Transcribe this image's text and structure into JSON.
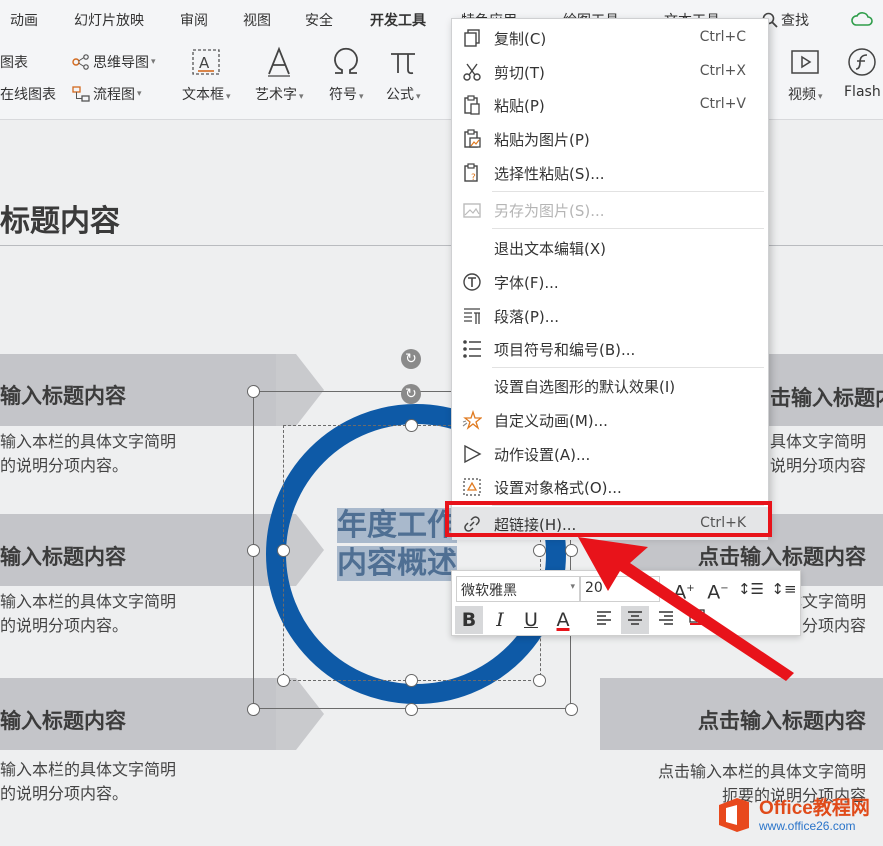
{
  "ribbon": {
    "tabs": [
      "动画",
      "幻灯片放映",
      "审阅",
      "视图",
      "安全",
      "开发工具",
      "特色应用",
      "绘图工具",
      "文本工具"
    ],
    "search": "查找",
    "tools_small": [
      "图表",
      "在线图表",
      "思维导图",
      "流程图"
    ],
    "tools_big": [
      "文本框",
      "艺术字",
      "符号",
      "公式",
      "视频",
      "Flash"
    ]
  },
  "slide": {
    "title": "标题内容",
    "items": [
      {
        "title": "输入标题内容",
        "body1": "输入本栏的具体文字简明",
        "body2": "的说明分项内容。"
      },
      {
        "title": "输入标题内容",
        "body1": "输入本栏的具体文字简明",
        "body2": "的说明分项内容。"
      },
      {
        "title": "输入标题内容",
        "body1": "输入本栏的具体文字简明",
        "body2": "的说明分项内容。"
      },
      {
        "title": "击输入标题内容",
        "body1": "具体文字简明",
        "body2": "说明分项内容"
      },
      {
        "title": "点击输入标题内容",
        "body1": "点击输入本栏的具体文字简明",
        "body2": "扼要的说明分项内容"
      },
      {
        "title": "点击输入标题内容",
        "body1": "点击输入本栏的具体文字简明",
        "body2": "扼要的说明分项内容"
      }
    ],
    "center_line1": "年度工作",
    "center_line2": "内容概述",
    "ring_color": "#0e5aa7"
  },
  "context_menu": {
    "items": [
      {
        "label": "复制(C)",
        "shortcut": "Ctrl+C",
        "icon": "copy-icon"
      },
      {
        "label": "剪切(T)",
        "shortcut": "Ctrl+X",
        "icon": "scissors-icon"
      },
      {
        "label": "粘贴(P)",
        "shortcut": "Ctrl+V",
        "icon": "paste-icon"
      },
      {
        "label": "粘贴为图片(P)",
        "shortcut": "",
        "icon": "paste-image-icon"
      },
      {
        "label": "选择性粘贴(S)...",
        "shortcut": "",
        "icon": "paste-special-icon"
      },
      {
        "label": "另存为图片(S)...",
        "shortcut": "",
        "icon": "image-icon",
        "disabled": true
      },
      {
        "label": "退出文本编辑(X)",
        "shortcut": ""
      },
      {
        "label": "字体(F)...",
        "shortcut": "",
        "icon": "font-icon"
      },
      {
        "label": "段落(P)...",
        "shortcut": "",
        "icon": "paragraph-icon"
      },
      {
        "label": "项目符号和编号(B)...",
        "shortcut": "",
        "icon": "bullets-icon"
      },
      {
        "label": "设置自选图形的默认效果(I)",
        "shortcut": ""
      },
      {
        "label": "自定义动画(M)...",
        "shortcut": "",
        "icon": "star-animation-icon"
      },
      {
        "label": "动作设置(A)...",
        "shortcut": "",
        "icon": "play-icon"
      },
      {
        "label": "设置对象格式(O)...",
        "shortcut": "",
        "icon": "format-object-icon"
      },
      {
        "label": "超链接(H)...",
        "shortcut": "Ctrl+K",
        "icon": "link-icon",
        "highlighted": true
      }
    ]
  },
  "mini_toolbar": {
    "font": "微软雅黑",
    "size": "20",
    "buttons": [
      "B",
      "I",
      "U",
      "A"
    ]
  },
  "watermark": {
    "name": "Office教程网",
    "url": "www.office26.com"
  },
  "colors": {
    "accent_red": "#e8131a",
    "ring_blue": "#0e5aa7"
  }
}
